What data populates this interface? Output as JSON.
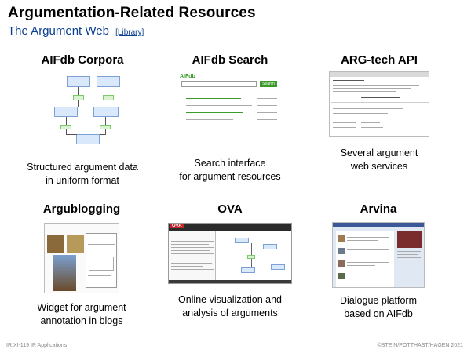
{
  "header": {
    "title": "Argumentation-Related Resources",
    "subtitle": "The Argument Web",
    "library_link": "[Library]"
  },
  "cards": [
    {
      "title": "AIFdb Corpora",
      "desc_line1": "Structured argument data",
      "desc_line2": "in uniform format"
    },
    {
      "title": "AIFdb Search",
      "desc_line1": "Search interface",
      "desc_line2": "for argument resources",
      "thumb_logo": "AIFdb",
      "thumb_search": "Search"
    },
    {
      "title": "ARG-tech API",
      "desc_line1": "Several argument",
      "desc_line2": "web services"
    },
    {
      "title": "Argublogging",
      "desc_line1": "Widget for argument",
      "desc_line2": "annotation in blogs"
    },
    {
      "title": "OVA",
      "desc_line1": "Online visualization and",
      "desc_line2": "analysis of arguments",
      "thumb_logo": "OVA"
    },
    {
      "title": "Arvina",
      "desc_line1": "Dialogue platform",
      "desc_line2": "based on AIFdb"
    }
  ],
  "footer": {
    "left": "IR:XI-119   IR Applications",
    "right": "©STEIN/POTTHAST/HAGEN 2021"
  },
  "colors": {
    "subtitle": "#0a3f8f",
    "node_blue": "#d9e8fb",
    "node_green": "#d9f2d0",
    "search_green": "#3a9b2a",
    "ova_red": "#c0272d"
  }
}
